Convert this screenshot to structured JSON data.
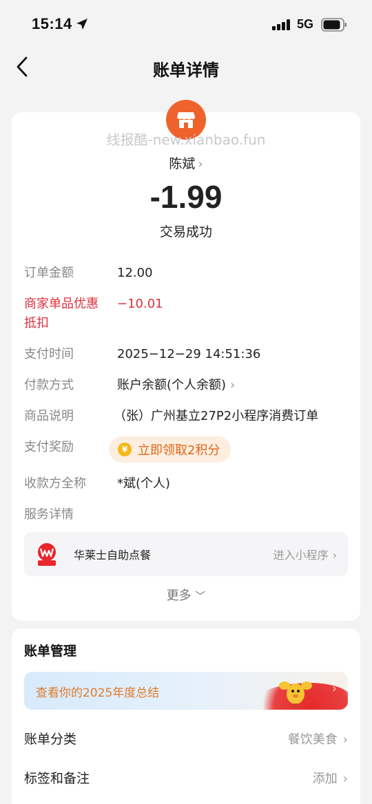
{
  "status_bar": {
    "time": "15:14",
    "network": "5G"
  },
  "nav": {
    "title": "账单详情"
  },
  "bill": {
    "watermark": "线报酷-new.xianbao.fun",
    "payee": "陈斌",
    "amount": "-1.99",
    "status": "交易成功",
    "rows": [
      {
        "label": "订单金额",
        "value": "12.00"
      },
      {
        "label": "商家单品优惠",
        "label2": "抵扣",
        "value": "−10.01"
      },
      {
        "label": "支付时间",
        "value": "2025−12−29 14:51:36"
      },
      {
        "label": "付款方式",
        "value": "账户余额(个人余额)"
      },
      {
        "label": "商品说明",
        "value": "（张）广州基立27P2小程序消费订单"
      },
      {
        "label": "支付奖励",
        "value": "立即领取2积分"
      },
      {
        "label": "收款方全称",
        "value": "*斌(个人)"
      },
      {
        "label": "服务详情"
      }
    ],
    "service": {
      "name": "华莱士自助点餐",
      "action": "进入小程序",
      "logo_text": "华莱士"
    },
    "more": "更多"
  },
  "management": {
    "title": "账单管理",
    "banner": "查看你的2025年度总结",
    "rows": [
      {
        "label": "账单分类",
        "value": "餐饮美食"
      },
      {
        "label": "标签和备注",
        "value": "添加"
      }
    ]
  },
  "colors": {
    "accent_orange": "#f0622b",
    "discount_red": "#e0303c",
    "reward_orange": "#e46418"
  }
}
